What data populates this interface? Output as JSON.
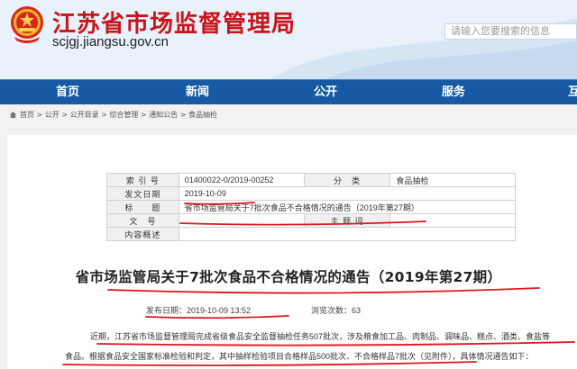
{
  "header": {
    "site_title": "江苏省市场监督管理局",
    "site_url": "scjgj.jiangsu.gov.cn",
    "search_placeholder": "请输入您要搜索的信息"
  },
  "nav": {
    "items": [
      "首页",
      "新闻",
      "公开",
      "服务",
      "互"
    ]
  },
  "breadcrumb": {
    "text": "首页 > 公开 > 公开目录 > 综合管理 > 通知公告 > 食品抽检"
  },
  "meta_table": {
    "index_label": "索 引 号",
    "index_value": "01400022-0/2019-00252",
    "category_label": "分　类",
    "category_value": "食品抽检",
    "date_label": "发文日期",
    "date_value": "2019-10-09",
    "subject_label": "标　　题",
    "subject_value": "省市场监管局关于7批次食品不合格情况的通告（2019年第27期）",
    "docno_label": "文　号",
    "docno_value": "",
    "keywords_label": "主 题 词",
    "keywords_value": "",
    "summary_label": "内容概述",
    "summary_value": ""
  },
  "article": {
    "title": "省市场监管局关于7批次食品不合格情况的通告（2019年第27期）",
    "publish_time": "发布日期：2019-10-09 13:52",
    "views": "浏览次数：63",
    "line1": "近期，江苏省市场监督管理局完成省级食品安全监督抽检任务507批次，涉及粮食加工品、肉制品、调味品、糕点、酒类、食盐等",
    "line2": "食品。根据食品安全国家标准检验和判定，其中抽样检验项目合格样品500批次、不合格样品7批次（见附件），具体情况通告如下："
  },
  "colors": {
    "brand_red": "#c8141b",
    "nav_blue": "#175aa3",
    "annotation_red": "#e0141e"
  }
}
